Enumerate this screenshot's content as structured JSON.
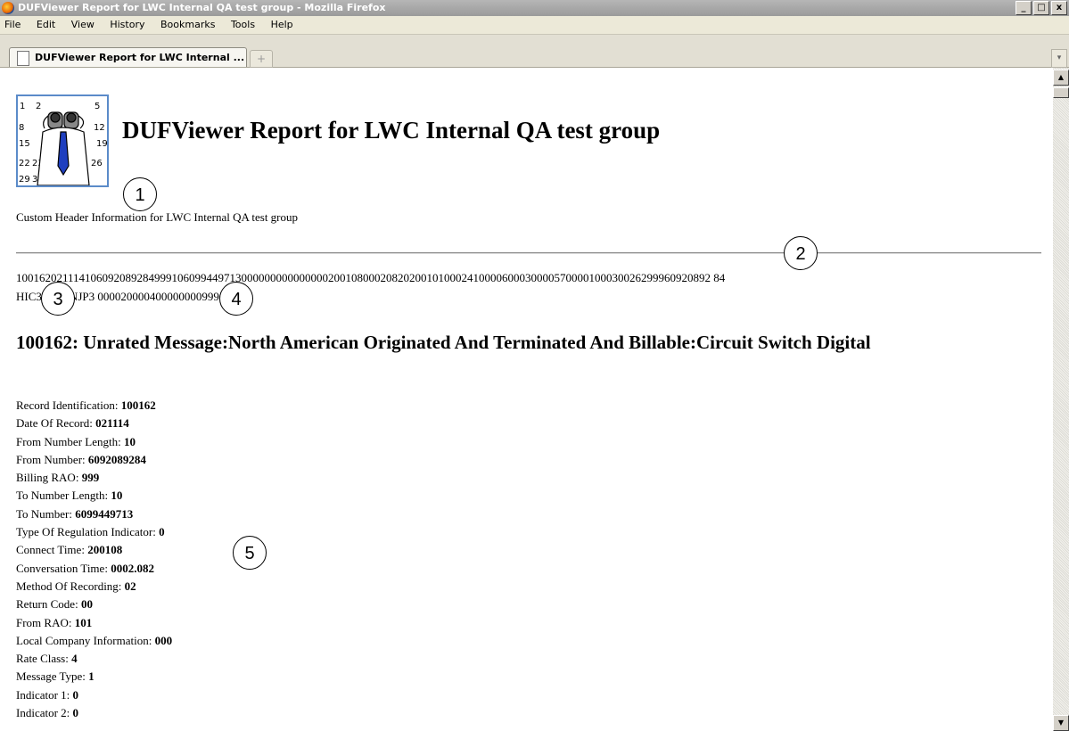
{
  "window": {
    "title": "DUFViewer Report for LWC Internal QA test group - Mozilla Firefox",
    "buttons": [
      "_",
      "□",
      "x"
    ]
  },
  "menu": [
    "File",
    "Edit",
    "View",
    "History",
    "Bookmarks",
    "Tools",
    "Help"
  ],
  "tabs": [
    {
      "label": "DUFViewer Report for LWC Internal ..."
    }
  ],
  "newtab_symbol": "+",
  "page": {
    "heading": "DUFViewer Report for LWC Internal QA test group",
    "logo_days": [
      "1",
      "2",
      "5",
      "8",
      "12",
      "15",
      "19",
      "22",
      "23",
      "26",
      "29",
      "30"
    ],
    "custom_header": "Custom Header Information for LWC Internal QA test group",
    "raw_line1": "100162021114106092089284999106099449713000000000000000200108000208202001010002410000600030000570000100030026299960920892 84",
    "raw_line2": "HIC3OWNNJP3 00002000040000000099900",
    "record_title": "100162: Unrated Message:North American Originated And Terminated And Billable:Circuit Switch Digital",
    "fields": [
      {
        "label": "Record Identification: ",
        "value": "100162"
      },
      {
        "label": "Date Of Record: ",
        "value": "021114"
      },
      {
        "label": "From Number Length: ",
        "value": "10"
      },
      {
        "label": "From Number: ",
        "value": "6092089284"
      },
      {
        "label": "Billing RAO: ",
        "value": "999"
      },
      {
        "label": "To Number Length: ",
        "value": "10"
      },
      {
        "label": "To Number: ",
        "value": "6099449713"
      },
      {
        "label": "Type Of Regulation Indicator: ",
        "value": "0"
      },
      {
        "label": "Connect Time: ",
        "value": "200108"
      },
      {
        "label": "Conversation Time: ",
        "value": "0002.082"
      },
      {
        "label": "Method Of Recording: ",
        "value": "02"
      },
      {
        "label": "Return Code: ",
        "value": "00"
      },
      {
        "label": "From RAO: ",
        "value": "101"
      },
      {
        "label": "Local Company Information: ",
        "value": "000"
      },
      {
        "label": "Rate Class: ",
        "value": "4"
      },
      {
        "label": "Message Type: ",
        "value": "1"
      },
      {
        "label": "Indicator 1: ",
        "value": "0"
      },
      {
        "label": "Indicator 2: ",
        "value": "0"
      }
    ]
  },
  "callouts": [
    "1",
    "2",
    "3",
    "4",
    "5"
  ]
}
